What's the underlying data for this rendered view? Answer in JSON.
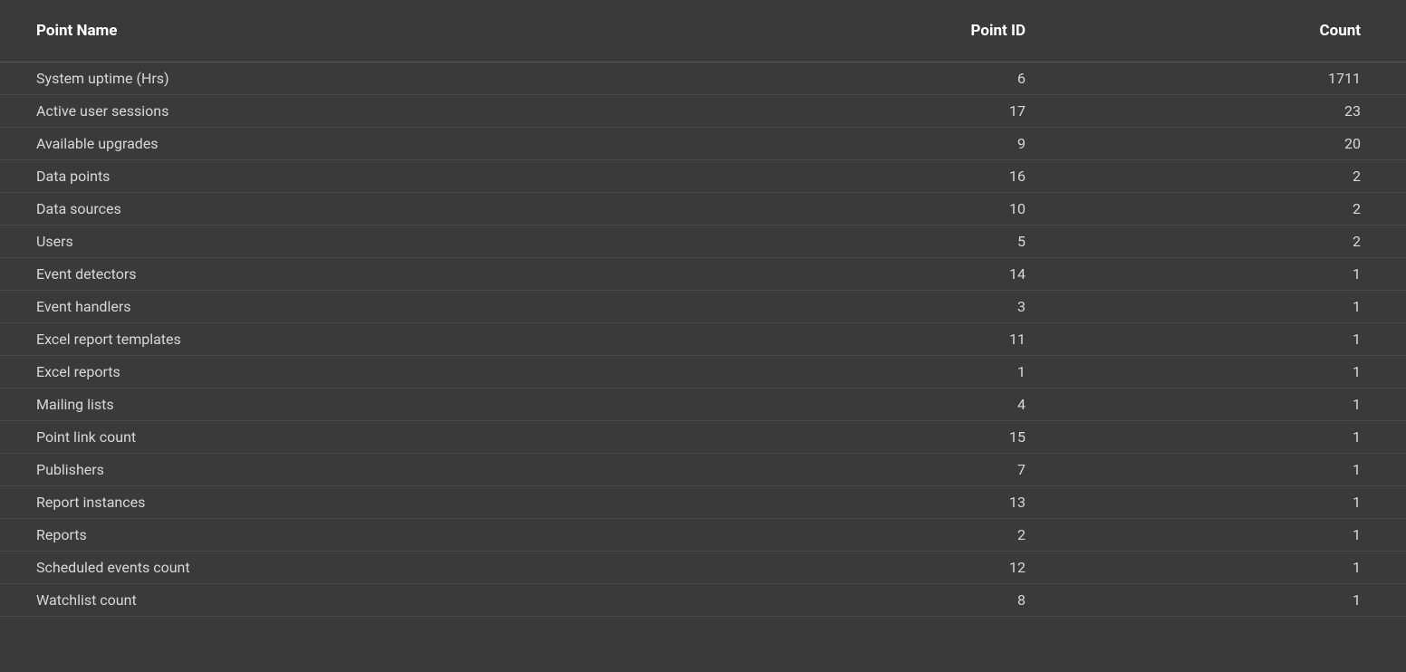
{
  "table": {
    "headers": {
      "point_name": "Point Name",
      "point_id": "Point ID",
      "count": "Count"
    },
    "rows": [
      {
        "point_name": "System uptime (Hrs)",
        "point_id": "6",
        "count": "1711"
      },
      {
        "point_name": "Active user sessions",
        "point_id": "17",
        "count": "23"
      },
      {
        "point_name": "Available upgrades",
        "point_id": "9",
        "count": "20"
      },
      {
        "point_name": "Data points",
        "point_id": "16",
        "count": "2"
      },
      {
        "point_name": "Data sources",
        "point_id": "10",
        "count": "2"
      },
      {
        "point_name": "Users",
        "point_id": "5",
        "count": "2"
      },
      {
        "point_name": "Event detectors",
        "point_id": "14",
        "count": "1"
      },
      {
        "point_name": "Event handlers",
        "point_id": "3",
        "count": "1"
      },
      {
        "point_name": "Excel report templates",
        "point_id": "11",
        "count": "1"
      },
      {
        "point_name": "Excel reports",
        "point_id": "1",
        "count": "1"
      },
      {
        "point_name": "Mailing lists",
        "point_id": "4",
        "count": "1"
      },
      {
        "point_name": "Point link count",
        "point_id": "15",
        "count": "1"
      },
      {
        "point_name": "Publishers",
        "point_id": "7",
        "count": "1"
      },
      {
        "point_name": "Report instances",
        "point_id": "13",
        "count": "1"
      },
      {
        "point_name": "Reports",
        "point_id": "2",
        "count": "1"
      },
      {
        "point_name": "Scheduled events count",
        "point_id": "12",
        "count": "1"
      },
      {
        "point_name": "Watchlist count",
        "point_id": "8",
        "count": "1"
      }
    ]
  }
}
